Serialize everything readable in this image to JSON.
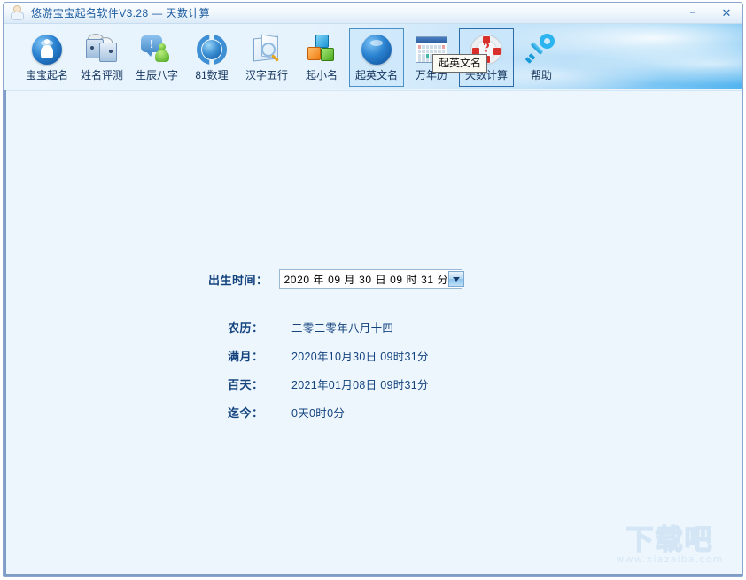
{
  "window": {
    "title": "悠游宝宝起名软件V3.28  —  天数计算",
    "icon": "baby-icon",
    "controls": {
      "minimize": "–",
      "close": "✕"
    }
  },
  "toolbar": {
    "items": [
      {
        "label": "宝宝起名",
        "icon": "accessibility-disc-icon",
        "state": "normal"
      },
      {
        "label": "姓名评测",
        "icon": "two-faces-icon",
        "state": "normal"
      },
      {
        "label": "生辰八字",
        "icon": "speech-bubble-person-icon",
        "state": "normal"
      },
      {
        "label": "81数理",
        "icon": "refresh-globe-icon",
        "state": "normal"
      },
      {
        "label": "汉字五行",
        "icon": "book-magnifier-icon",
        "state": "normal"
      },
      {
        "label": "起小名",
        "icon": "colored-cubes-icon",
        "state": "normal"
      },
      {
        "label": "起英文名",
        "icon": "blue-globe-icon",
        "state": "hovered"
      },
      {
        "label": "万年历",
        "icon": "calendar-icon",
        "state": "normal"
      },
      {
        "label": "天数计算",
        "icon": "lifebuoy-question-icon",
        "state": "selected"
      },
      {
        "label": "帮助",
        "icon": "key-icon",
        "state": "normal"
      }
    ]
  },
  "tooltip": {
    "text": "起英文名"
  },
  "form": {
    "birth_label": "出生时间：",
    "birth_value": "2020 年 09 月 30 日  09 时 31 分",
    "dropdown_icon": "chevron-down-icon",
    "results": [
      {
        "label": "农历：",
        "value": "二零二零年八月十四"
      },
      {
        "label": "满月：",
        "value": "2020年10月30日 09时31分"
      },
      {
        "label": "百天：",
        "value": "2021年01月08日 09时31分"
      },
      {
        "label": "迄今：",
        "value": "0天0时0分"
      }
    ]
  },
  "watermark": {
    "main": "下载吧",
    "sub": "www.xiazaiba.com"
  },
  "colors": {
    "accent": "#1a5a9e",
    "label": "#14437e",
    "toolbar_sky": "#53b4ef",
    "content_bg": "#edf6fd",
    "frame_border": "#7d9dc6"
  }
}
